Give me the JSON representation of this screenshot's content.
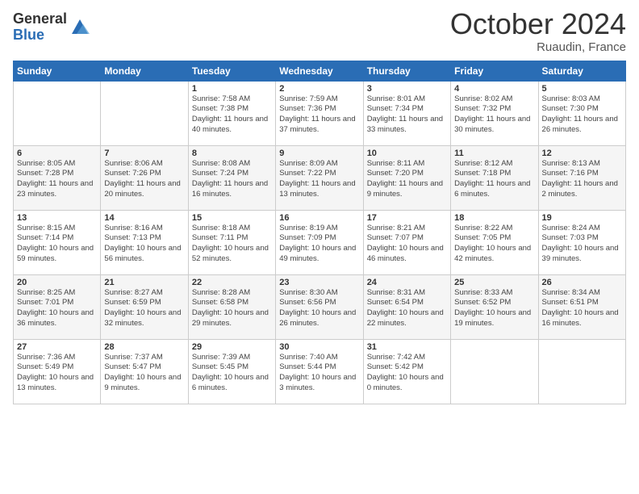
{
  "header": {
    "logo_general": "General",
    "logo_blue": "Blue",
    "title": "October 2024",
    "location": "Ruaudin, France"
  },
  "days_of_week": [
    "Sunday",
    "Monday",
    "Tuesday",
    "Wednesday",
    "Thursday",
    "Friday",
    "Saturday"
  ],
  "weeks": [
    [
      {
        "day": "",
        "info": ""
      },
      {
        "day": "",
        "info": ""
      },
      {
        "day": "1",
        "info": "Sunrise: 7:58 AM\nSunset: 7:38 PM\nDaylight: 11 hours\nand 40 minutes."
      },
      {
        "day": "2",
        "info": "Sunrise: 7:59 AM\nSunset: 7:36 PM\nDaylight: 11 hours\nand 37 minutes."
      },
      {
        "day": "3",
        "info": "Sunrise: 8:01 AM\nSunset: 7:34 PM\nDaylight: 11 hours\nand 33 minutes."
      },
      {
        "day": "4",
        "info": "Sunrise: 8:02 AM\nSunset: 7:32 PM\nDaylight: 11 hours\nand 30 minutes."
      },
      {
        "day": "5",
        "info": "Sunrise: 8:03 AM\nSunset: 7:30 PM\nDaylight: 11 hours\nand 26 minutes."
      }
    ],
    [
      {
        "day": "6",
        "info": "Sunrise: 8:05 AM\nSunset: 7:28 PM\nDaylight: 11 hours\nand 23 minutes."
      },
      {
        "day": "7",
        "info": "Sunrise: 8:06 AM\nSunset: 7:26 PM\nDaylight: 11 hours\nand 20 minutes."
      },
      {
        "day": "8",
        "info": "Sunrise: 8:08 AM\nSunset: 7:24 PM\nDaylight: 11 hours\nand 16 minutes."
      },
      {
        "day": "9",
        "info": "Sunrise: 8:09 AM\nSunset: 7:22 PM\nDaylight: 11 hours\nand 13 minutes."
      },
      {
        "day": "10",
        "info": "Sunrise: 8:11 AM\nSunset: 7:20 PM\nDaylight: 11 hours\nand 9 minutes."
      },
      {
        "day": "11",
        "info": "Sunrise: 8:12 AM\nSunset: 7:18 PM\nDaylight: 11 hours\nand 6 minutes."
      },
      {
        "day": "12",
        "info": "Sunrise: 8:13 AM\nSunset: 7:16 PM\nDaylight: 11 hours\nand 2 minutes."
      }
    ],
    [
      {
        "day": "13",
        "info": "Sunrise: 8:15 AM\nSunset: 7:14 PM\nDaylight: 10 hours\nand 59 minutes."
      },
      {
        "day": "14",
        "info": "Sunrise: 8:16 AM\nSunset: 7:13 PM\nDaylight: 10 hours\nand 56 minutes."
      },
      {
        "day": "15",
        "info": "Sunrise: 8:18 AM\nSunset: 7:11 PM\nDaylight: 10 hours\nand 52 minutes."
      },
      {
        "day": "16",
        "info": "Sunrise: 8:19 AM\nSunset: 7:09 PM\nDaylight: 10 hours\nand 49 minutes."
      },
      {
        "day": "17",
        "info": "Sunrise: 8:21 AM\nSunset: 7:07 PM\nDaylight: 10 hours\nand 46 minutes."
      },
      {
        "day": "18",
        "info": "Sunrise: 8:22 AM\nSunset: 7:05 PM\nDaylight: 10 hours\nand 42 minutes."
      },
      {
        "day": "19",
        "info": "Sunrise: 8:24 AM\nSunset: 7:03 PM\nDaylight: 10 hours\nand 39 minutes."
      }
    ],
    [
      {
        "day": "20",
        "info": "Sunrise: 8:25 AM\nSunset: 7:01 PM\nDaylight: 10 hours\nand 36 minutes."
      },
      {
        "day": "21",
        "info": "Sunrise: 8:27 AM\nSunset: 6:59 PM\nDaylight: 10 hours\nand 32 minutes."
      },
      {
        "day": "22",
        "info": "Sunrise: 8:28 AM\nSunset: 6:58 PM\nDaylight: 10 hours\nand 29 minutes."
      },
      {
        "day": "23",
        "info": "Sunrise: 8:30 AM\nSunset: 6:56 PM\nDaylight: 10 hours\nand 26 minutes."
      },
      {
        "day": "24",
        "info": "Sunrise: 8:31 AM\nSunset: 6:54 PM\nDaylight: 10 hours\nand 22 minutes."
      },
      {
        "day": "25",
        "info": "Sunrise: 8:33 AM\nSunset: 6:52 PM\nDaylight: 10 hours\nand 19 minutes."
      },
      {
        "day": "26",
        "info": "Sunrise: 8:34 AM\nSunset: 6:51 PM\nDaylight: 10 hours\nand 16 minutes."
      }
    ],
    [
      {
        "day": "27",
        "info": "Sunrise: 7:36 AM\nSunset: 5:49 PM\nDaylight: 10 hours\nand 13 minutes."
      },
      {
        "day": "28",
        "info": "Sunrise: 7:37 AM\nSunset: 5:47 PM\nDaylight: 10 hours\nand 9 minutes."
      },
      {
        "day": "29",
        "info": "Sunrise: 7:39 AM\nSunset: 5:45 PM\nDaylight: 10 hours\nand 6 minutes."
      },
      {
        "day": "30",
        "info": "Sunrise: 7:40 AM\nSunset: 5:44 PM\nDaylight: 10 hours\nand 3 minutes."
      },
      {
        "day": "31",
        "info": "Sunrise: 7:42 AM\nSunset: 5:42 PM\nDaylight: 10 hours\nand 0 minutes."
      },
      {
        "day": "",
        "info": ""
      },
      {
        "day": "",
        "info": ""
      }
    ]
  ]
}
